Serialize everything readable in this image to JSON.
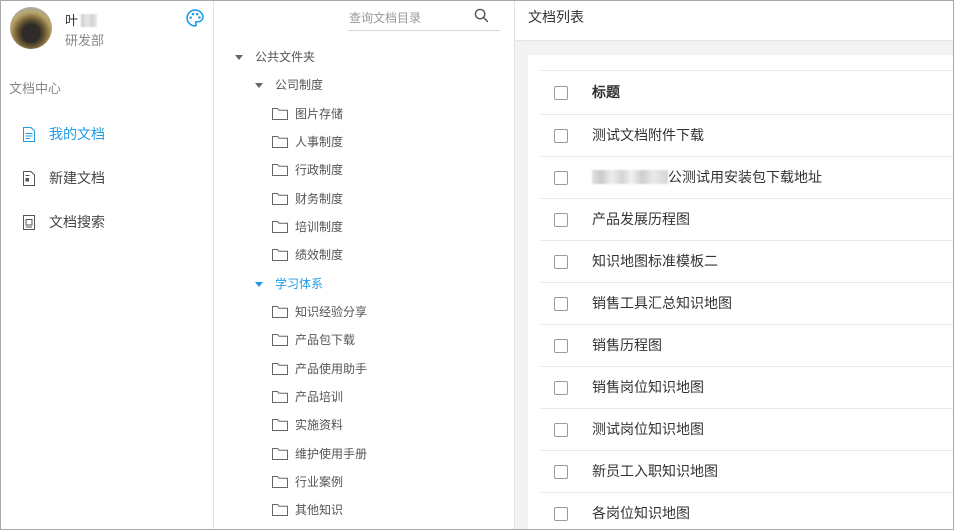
{
  "user": {
    "name": "叶",
    "department": "研发部",
    "avatar": "user-avatar"
  },
  "toolbar": {
    "theme_icon": "palette-icon"
  },
  "sidebar": {
    "section_title": "文档中心",
    "items": [
      {
        "label": "我的文档",
        "icon": "my-documents-icon",
        "active": true
      },
      {
        "label": "新建文档",
        "icon": "new-document-icon",
        "active": false
      },
      {
        "label": "文档搜索",
        "icon": "document-search-icon",
        "active": false
      }
    ]
  },
  "tree": {
    "search_placeholder": "查询文档目录",
    "search_icon": "search-icon",
    "root": {
      "label": "公共文件夹",
      "expanded": true
    },
    "groups": [
      {
        "label": "公司制度",
        "expanded": true,
        "selected": false,
        "folders": [
          "图片存储",
          "人事制度",
          "行政制度",
          "财务制度",
          "培训制度",
          "绩效制度"
        ]
      },
      {
        "label": "学习体系",
        "expanded": true,
        "selected": true,
        "folders": [
          "知识经验分享",
          "产品包下载",
          "产品使用助手",
          "产品培训",
          "实施资料",
          "维护使用手册",
          "行业案例",
          "其他知识"
        ]
      }
    ]
  },
  "main": {
    "title": "文档列表",
    "table": {
      "column_title": "标题",
      "rows": [
        "测试文档附件下载",
        "公测试用安装包下载地址",
        "产品发展历程图",
        "知识地图标准模板二",
        "销售工具汇总知识地图",
        "销售历程图",
        "销售岗位知识地图",
        "测试岗位知识地图",
        "新员工入职知识地图",
        "各岗位知识地图"
      ]
    }
  },
  "colors": {
    "accent": "#1f9be5",
    "panel_background": "#f2f3f5",
    "text": "#333333"
  }
}
